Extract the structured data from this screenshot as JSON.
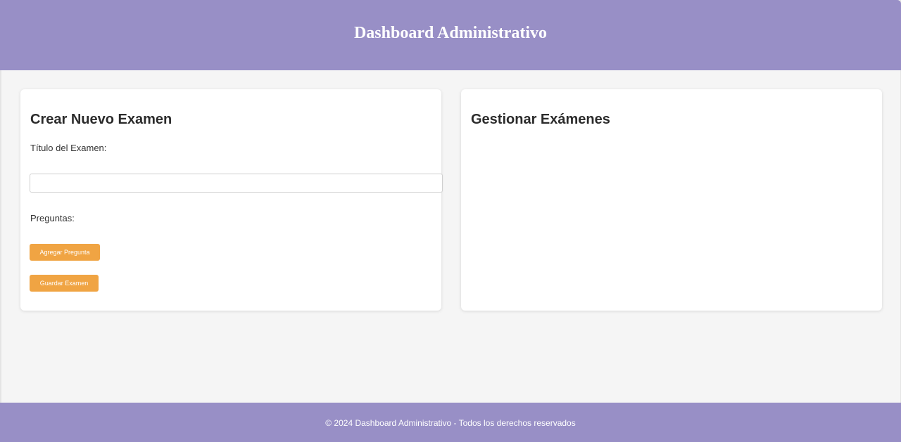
{
  "header": {
    "title": "Dashboard Administrativo"
  },
  "create_exam": {
    "heading": "Crear Nuevo Examen",
    "title_label": "Título del Examen:",
    "title_value": "",
    "title_placeholder": "",
    "questions_label": "Preguntas:",
    "add_question_button": "Agregar Pregunta",
    "save_exam_button": "Guardar Examen"
  },
  "manage_exams": {
    "heading": "Gestionar Exámenes"
  },
  "footer": {
    "text": "© 2024 Dashboard Administrativo - Todos los derechos reservados"
  },
  "colors": {
    "header_bg": "#988fc6",
    "footer_bg": "#988fc6",
    "button_bg": "#f0a443",
    "page_bg": "#f5f5f5"
  }
}
